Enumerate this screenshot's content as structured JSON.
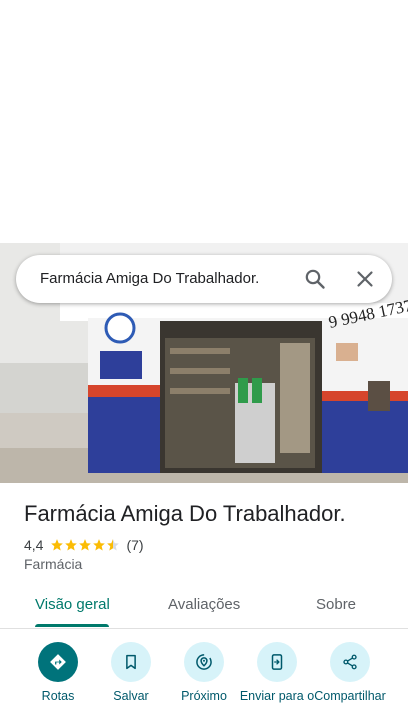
{
  "search": {
    "query": "Farmácia Amiga Do Trabalhador."
  },
  "photo": {
    "sign_phone": "9 9948 1737"
  },
  "place": {
    "title": "Farmácia Amiga Do Trabalhador.",
    "rating": "4,4",
    "rating_value": 4.4,
    "review_count": "(7)",
    "category": "Farmácia"
  },
  "tabs": [
    {
      "label": "Visão geral"
    },
    {
      "label": "Avaliações"
    },
    {
      "label": "Sobre"
    }
  ],
  "actions": [
    {
      "label": "Rotas",
      "icon": "directions-icon"
    },
    {
      "label": "Salvar",
      "icon": "bookmark-icon"
    },
    {
      "label": "Próximo",
      "icon": "nearby-icon"
    },
    {
      "label": "Enviar para o",
      "icon": "send-to-phone-icon"
    },
    {
      "label": "Compartilhar",
      "icon": "share-icon"
    }
  ],
  "colors": {
    "accent": "#00796b",
    "star": "#fbbc04",
    "action_bg": "#d7f3f9",
    "primary_action": "#00737b"
  }
}
